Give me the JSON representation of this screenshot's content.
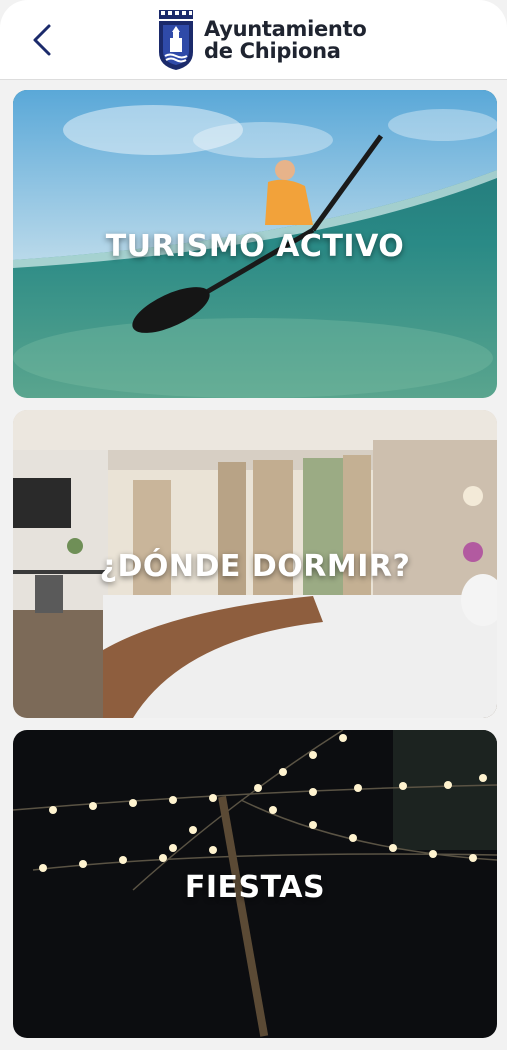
{
  "header": {
    "logo_line1": "Ayuntamiento",
    "logo_line2": "de Chipiona",
    "back_icon": "chevron-left-icon",
    "accent": "#1b2a6b"
  },
  "cards": [
    {
      "title": "TURISMO ACTIVO"
    },
    {
      "title": "¿DÓNDE DORMIR?"
    },
    {
      "title": "FIESTAS"
    }
  ]
}
